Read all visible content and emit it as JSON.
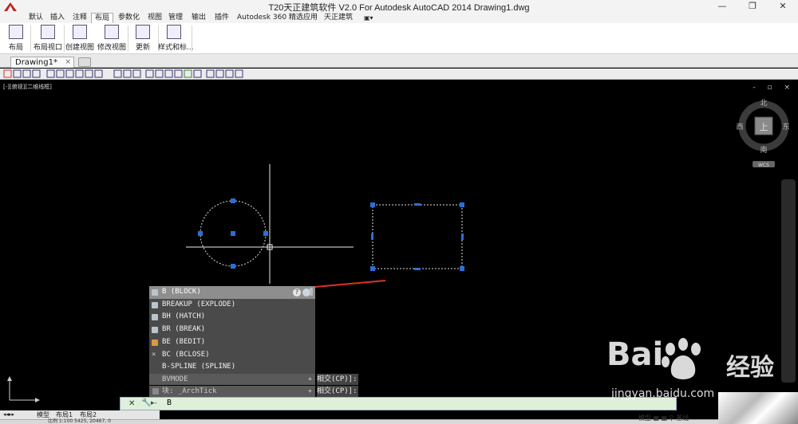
{
  "title": "T20天正建筑软件 V2.0 For Autodesk AutoCAD 2014    Drawing1.dwg",
  "window_buttons": [
    "—",
    "❐",
    "✕"
  ],
  "menu_tabs": [
    "默认",
    "插入",
    "注释",
    "布局",
    "参数化",
    "视图",
    "管理",
    "输出",
    "插件",
    "Autodesk 360",
    "精选应用",
    "天正建筑"
  ],
  "active_menu_tab": "布局",
  "ribbon": {
    "buttons": [
      "布局",
      "布局视口",
      "创建视图",
      "修改视图",
      "更新",
      "样式和标..."
    ]
  },
  "document": {
    "tab_label": "Drawing1*",
    "close": "×"
  },
  "viewport": {
    "label": "[-][俯视][二维线框]",
    "controls": "- ▫ ×"
  },
  "viewcube": {
    "north": "北",
    "south": "南",
    "east": "东",
    "west": "西",
    "top": "上",
    "wcs": "WCS"
  },
  "autocomplete": {
    "items": [
      "B (BLOCK)",
      "BREAKUP (EXPLODE)",
      "BH (HATCH)",
      "BR (BREAK)",
      "BE (BEDIT)",
      "BC (BCLOSE)",
      "B-SPLINE (SPLINE)"
    ],
    "help_icon": "?"
  },
  "history": [
    {
      "left": "BVMODE",
      "right": "相交(CP)]:"
    },
    {
      "left": "块: _ArchTick",
      "right": "相交(CP)]:"
    }
  ],
  "command_line": {
    "close": "✕",
    "prompt": "▸-",
    "value": "B"
  },
  "layout_tabs": [
    "模型",
    "布局1",
    "布局2"
  ],
  "status": {
    "scale": "比例 1:100",
    "coords": "5425, 20467, 0",
    "right": "模型 ▦ ▦ ⚲ 基线"
  },
  "watermark": {
    "brand_left": "Bai",
    "brand_right": "经验",
    "url": "jingyan.baidu.com"
  }
}
